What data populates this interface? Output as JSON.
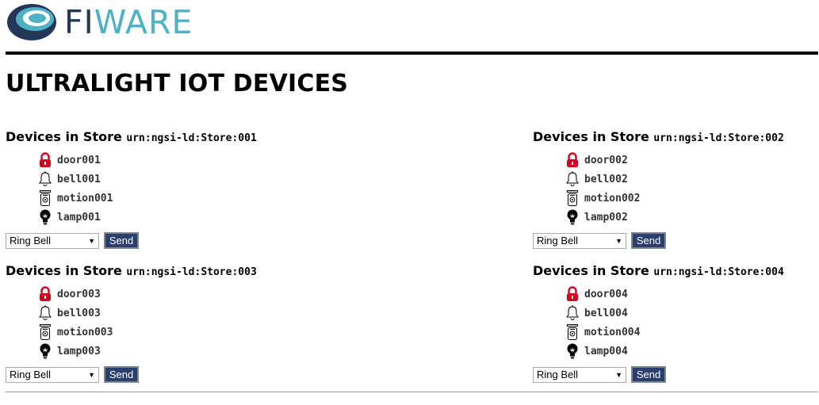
{
  "brand": {
    "fi": "FI",
    "ware": "WARE"
  },
  "page_title": "ULTRALIGHT IOT DEVICES",
  "stores": [
    {
      "heading": "Devices in Store",
      "urn": "urn:ngsi-ld:Store:001",
      "devices": [
        {
          "icon": "lock-icon",
          "name": "door001"
        },
        {
          "icon": "bell-icon",
          "name": "bell001"
        },
        {
          "icon": "motion-sensor-icon",
          "name": "motion001"
        },
        {
          "icon": "lightbulb-icon",
          "name": "lamp001"
        }
      ],
      "command": "Ring Bell",
      "send_label": "Send"
    },
    {
      "heading": "Devices in Store",
      "urn": "urn:ngsi-ld:Store:002",
      "devices": [
        {
          "icon": "lock-icon",
          "name": "door002"
        },
        {
          "icon": "bell-icon",
          "name": "bell002"
        },
        {
          "icon": "motion-sensor-icon",
          "name": "motion002"
        },
        {
          "icon": "lightbulb-icon",
          "name": "lamp002"
        }
      ],
      "command": "Ring Bell",
      "send_label": "Send"
    },
    {
      "heading": "Devices in Store",
      "urn": "urn:ngsi-ld:Store:003",
      "devices": [
        {
          "icon": "lock-icon",
          "name": "door003"
        },
        {
          "icon": "bell-icon",
          "name": "bell003"
        },
        {
          "icon": "motion-sensor-icon",
          "name": "motion003"
        },
        {
          "icon": "lightbulb-icon",
          "name": "lamp003"
        }
      ],
      "command": "Ring Bell",
      "send_label": "Send"
    },
    {
      "heading": "Devices in Store",
      "urn": "urn:ngsi-ld:Store:004",
      "devices": [
        {
          "icon": "lock-icon",
          "name": "door004"
        },
        {
          "icon": "bell-icon",
          "name": "bell004"
        },
        {
          "icon": "motion-sensor-icon",
          "name": "motion004"
        },
        {
          "icon": "lightbulb-icon",
          "name": "lamp004"
        }
      ],
      "command": "Ring Bell",
      "send_label": "Send"
    }
  ],
  "colors": {
    "brand_dark": "#233858",
    "brand_light": "#4fb1c4",
    "lock_red": "#d0021b",
    "button": "#2a3f6d"
  }
}
